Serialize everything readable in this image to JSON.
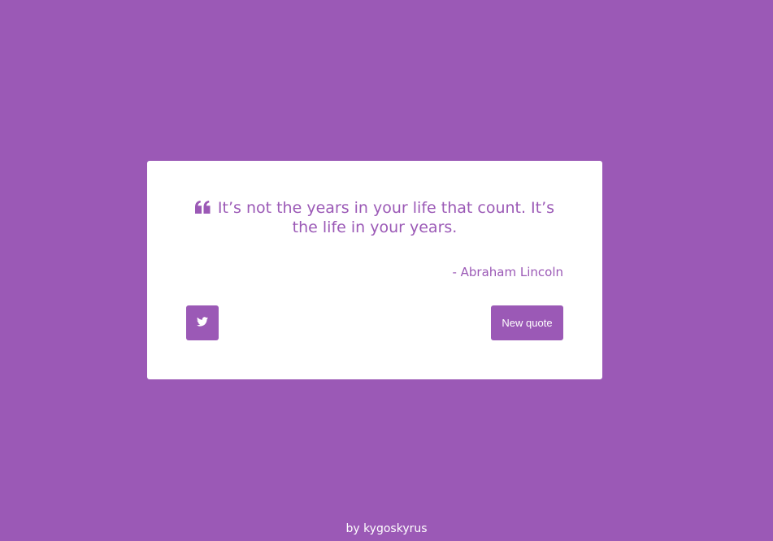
{
  "colors": {
    "background": "#9b59b6",
    "card": "#ffffff",
    "accent": "#9b59b6",
    "button_text": "#ffffff"
  },
  "quote": {
    "icon": "quote-left-icon",
    "text": "It’s not the years in your life that count. It’s the life in your years.",
    "author": "- Abraham Lincoln"
  },
  "actions": {
    "tweet_icon": "twitter-icon",
    "new_quote_label": "New quote"
  },
  "footer": {
    "prefix": "by",
    "author_link": "kygoskyrus"
  }
}
